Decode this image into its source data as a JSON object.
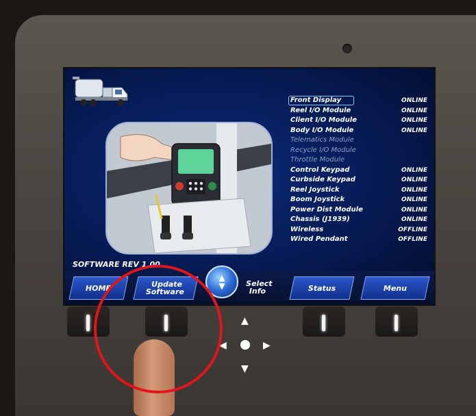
{
  "device": {
    "software_rev": "SOFTWARE REV  1.00",
    "modules": [
      {
        "name": "Front Display",
        "status": "ONLINE",
        "active": true,
        "selected": true
      },
      {
        "name": "Reel I/O Module",
        "status": "ONLINE",
        "active": true
      },
      {
        "name": "Client I/O Module",
        "status": "ONLINE",
        "active": true
      },
      {
        "name": "Body I/O Module",
        "status": "ONLINE",
        "active": true
      },
      {
        "name": "Telematics Module",
        "status": "",
        "active": false
      },
      {
        "name": "Recycle I/O Module",
        "status": "",
        "active": false
      },
      {
        "name": "Throttle Module",
        "status": "",
        "active": false
      },
      {
        "name": "Control Keypad",
        "status": "ONLINE",
        "active": true
      },
      {
        "name": "Curbside Keypad",
        "status": "ONLINE",
        "active": true
      },
      {
        "name": "Reel Joystick",
        "status": "ONLINE",
        "active": true
      },
      {
        "name": "Boom Joystick",
        "status": "ONLINE",
        "active": true
      },
      {
        "name": "Power Dist Module",
        "status": "ONLINE",
        "active": true
      },
      {
        "name": "Chassis (J1939)",
        "status": "ONLINE",
        "active": true
      },
      {
        "name": "Wireless",
        "status": "OFFLINE",
        "active": true
      },
      {
        "name": "Wired Pendant",
        "status": "OFFLINE",
        "active": true
      }
    ]
  },
  "softkeys": {
    "home": "HOME",
    "update_software_1": "Update",
    "update_software_2": "Software",
    "select_info_1": "Select",
    "select_info_2": "Info",
    "status": "Status",
    "menu": "Menu"
  },
  "icons": {
    "scroll": "up-down-arrows-icon",
    "truck": "vacuum-truck-icon",
    "dpad": "directional-pad-icon"
  },
  "colors": {
    "screen_bg": "#061a52",
    "softkey": "#2d58c8",
    "highlight": "#e0161b",
    "selected_border": "#7fd0ff"
  }
}
